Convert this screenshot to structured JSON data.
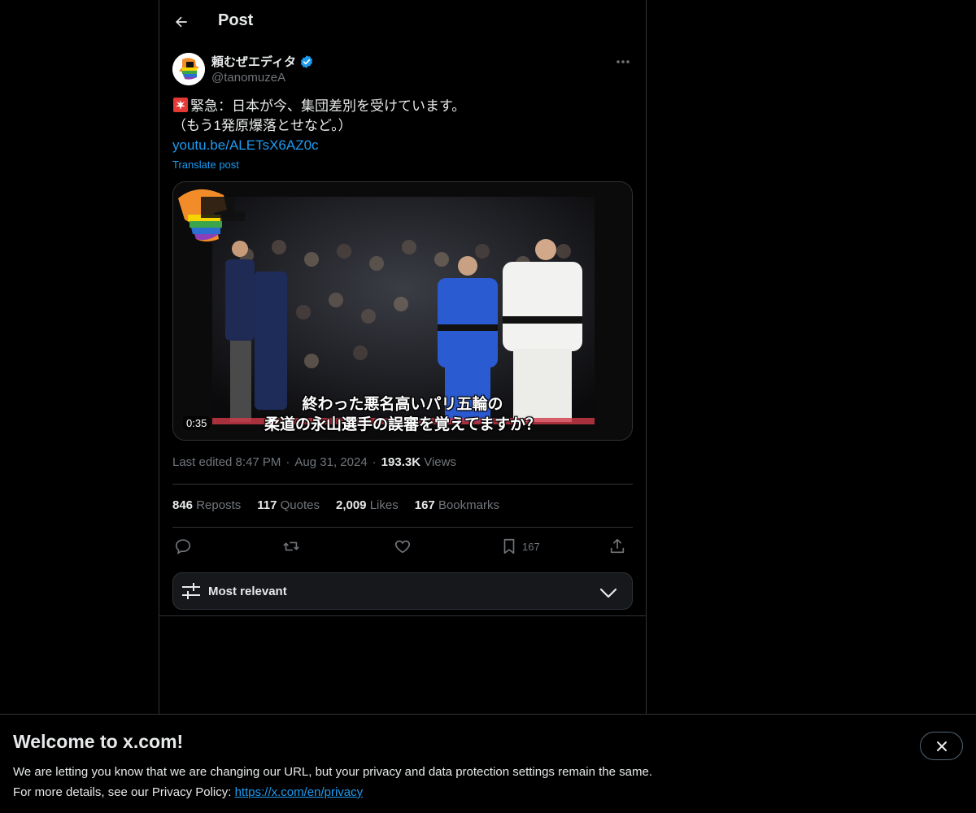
{
  "header": {
    "title": "Post"
  },
  "author": {
    "display_name": "頼むぜエディタ",
    "handle": "@tanomuzeA",
    "verified": true
  },
  "tweet": {
    "line1": "緊急：日本が今、集団差別を受けています。",
    "line2": "（もう1発原爆落とせなど。）",
    "link": "youtu.be/ALETsX6AZ0c",
    "translate_label": "Translate post"
  },
  "media": {
    "type": "video",
    "duration": "0:35",
    "subtitle_line1": "終わった悪名高いパリ五輪の",
    "subtitle_line2": "柔道の永山選手の誤審を覚えてますか？"
  },
  "meta": {
    "edited": "Last edited 8:47 PM",
    "date": "Aug 31, 2024",
    "views_count": "193.3K",
    "views_label": "Views"
  },
  "stats": [
    {
      "count": "846",
      "label": "Reposts"
    },
    {
      "count": "117",
      "label": "Quotes"
    },
    {
      "count": "2,009",
      "label": "Likes"
    },
    {
      "count": "167",
      "label": "Bookmarks"
    }
  ],
  "actions": {
    "bookmark_count": "167",
    "icons": [
      "reply-icon",
      "repost-icon",
      "like-icon",
      "bookmark-icon",
      "share-icon"
    ]
  },
  "sort": {
    "label": "Most relevant"
  },
  "banner": {
    "title": "Welcome to x.com!",
    "line1": "We are letting you know that we are changing our URL, but your privacy and data protection settings remain the same.",
    "line2_prefix": "For more details, see our Privacy Policy: ",
    "link": "https://x.com/en/privacy"
  },
  "colors": {
    "background": "#000000",
    "text": "#e7e9ea",
    "muted": "#71767b",
    "accent": "#1d9bf0",
    "border": "#2f3336"
  }
}
